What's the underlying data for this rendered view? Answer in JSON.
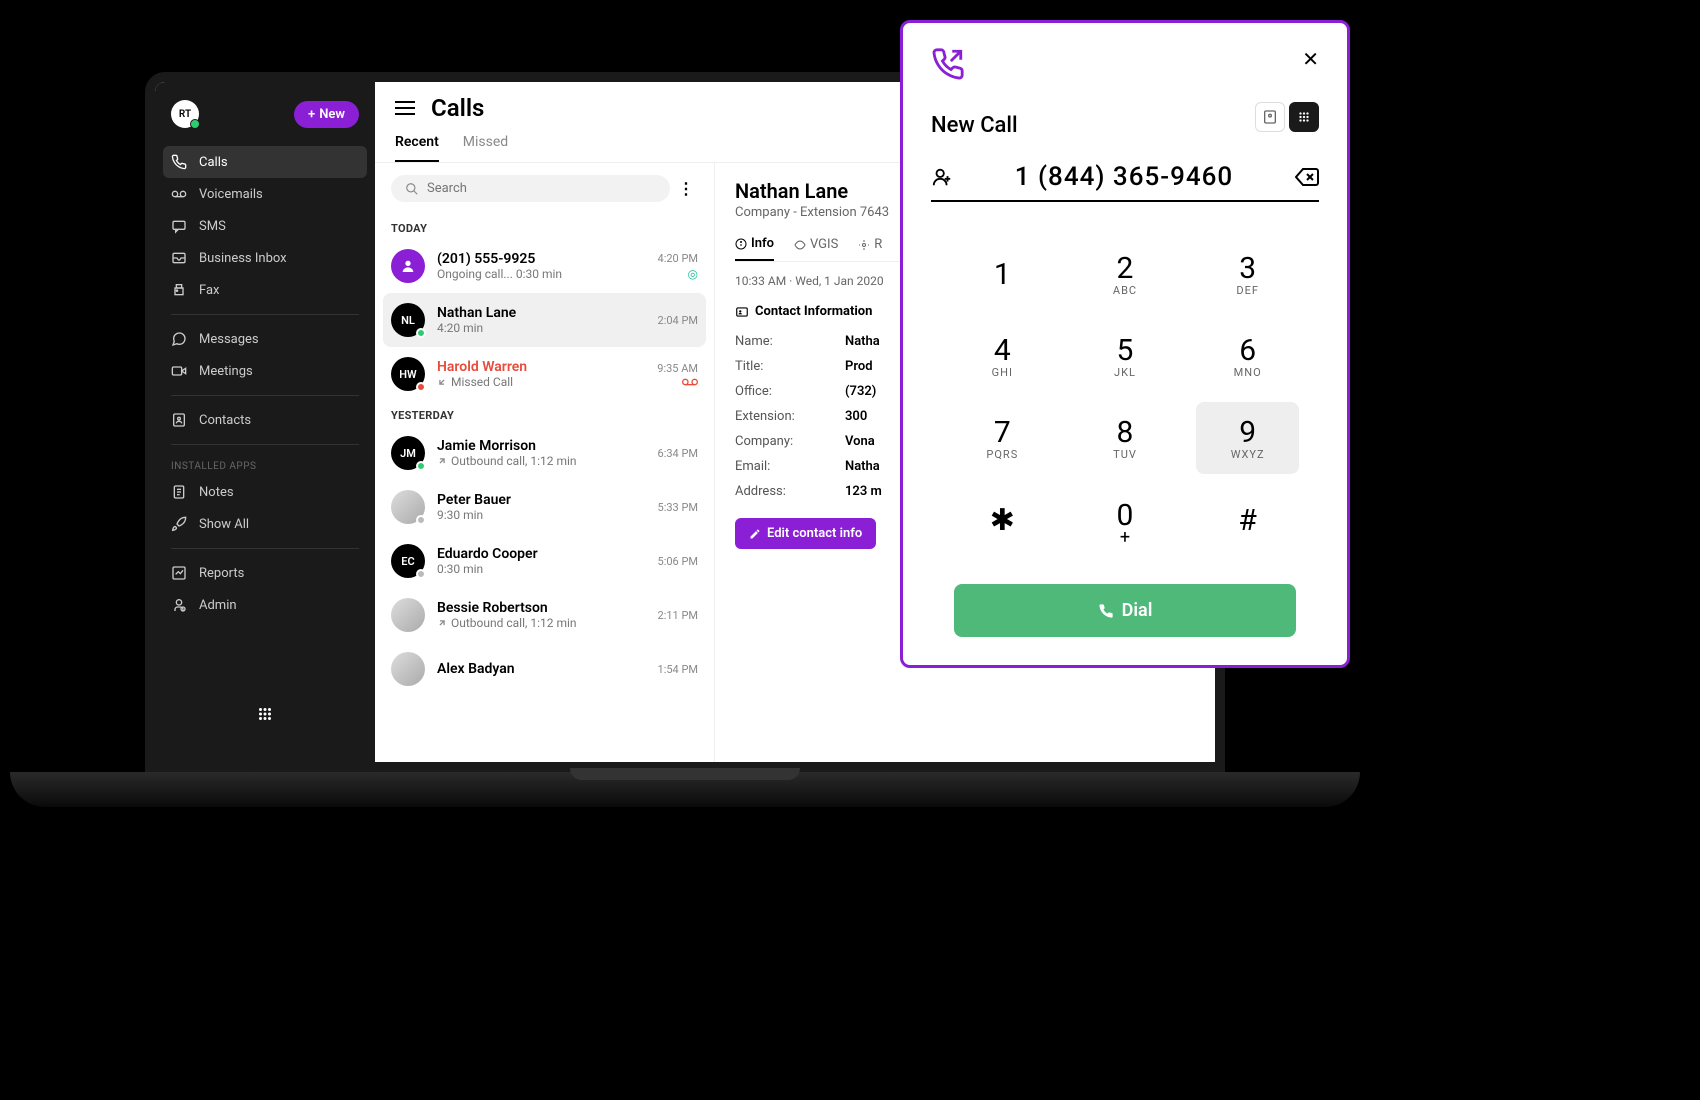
{
  "sidebar": {
    "avatar_initials": "RT",
    "new_button": "New",
    "items": [
      {
        "icon": "phone",
        "label": "Calls",
        "active": true
      },
      {
        "icon": "voicemail",
        "label": "Voicemails"
      },
      {
        "icon": "sms",
        "label": "SMS"
      },
      {
        "icon": "inbox",
        "label": "Business Inbox"
      },
      {
        "icon": "fax",
        "label": "Fax"
      }
    ],
    "comm": [
      {
        "icon": "message",
        "label": "Messages"
      },
      {
        "icon": "video",
        "label": "Meetings"
      }
    ],
    "contacts": {
      "icon": "contacts",
      "label": "Contacts"
    },
    "installed_header": "INSTALLED APPS",
    "installed": [
      {
        "icon": "notes",
        "label": "Notes"
      },
      {
        "icon": "rocket",
        "label": "Show All"
      }
    ],
    "footer": [
      {
        "icon": "reports",
        "label": "Reports"
      },
      {
        "icon": "admin",
        "label": "Admin"
      }
    ]
  },
  "main": {
    "title": "Calls",
    "tabs": [
      {
        "label": "Recent",
        "active": true
      },
      {
        "label": "Missed"
      }
    ],
    "search_placeholder": "Search",
    "groups": [
      {
        "label": "TODAY",
        "calls": [
          {
            "avatar": "icon",
            "color": "purple",
            "status": "none",
            "name": "(201) 555-9925",
            "sub": "Ongoing call... 0:30 min",
            "time": "4:20 PM",
            "badge": "live",
            "missed": false
          },
          {
            "avatar": "NL",
            "color": "dark",
            "status": "green",
            "name": "Nathan Lane",
            "sub": "4:20 min",
            "time": "2:04 PM",
            "selected": true
          },
          {
            "avatar": "HW",
            "color": "dark",
            "status": "red",
            "name": "Harold Warren",
            "sub": "Missed Call",
            "subicon": "missed",
            "time": "9:35 AM",
            "badge": "vm",
            "missed": true
          }
        ]
      },
      {
        "label": "YESTERDAY",
        "calls": [
          {
            "avatar": "JM",
            "color": "dark",
            "status": "green",
            "name": "Jamie Morrison",
            "sub": "Outbound call, 1:12 min",
            "subicon": "out",
            "time": "6:34 PM"
          },
          {
            "avatar": "img",
            "color": "img",
            "status": "gray",
            "name": "Peter Bauer",
            "sub": "9:30 min",
            "time": "5:33 PM"
          },
          {
            "avatar": "EC",
            "color": "dark",
            "status": "gray",
            "name": "Eduardo Cooper",
            "sub": "0:30 min",
            "time": "5:06 PM"
          },
          {
            "avatar": "img",
            "color": "img",
            "status": "none",
            "name": "Bessie Robertson",
            "sub": "Outbound call, 1:12 min",
            "subicon": "out",
            "time": "2:11 PM"
          },
          {
            "avatar": "img",
            "color": "img",
            "status": "none",
            "name": "Alex Badyan",
            "sub": "",
            "time": "1:54 PM"
          }
        ]
      }
    ]
  },
  "detail": {
    "name": "Nathan Lane",
    "subtitle": "Company -  Extension 7643",
    "tabs": [
      {
        "label": "Info",
        "active": true
      },
      {
        "label": "VGIS"
      },
      {
        "label": "R"
      }
    ],
    "meta": "10:33 AM  ·  Wed, 1 Jan 2020",
    "section": "Contact Information",
    "fields": [
      {
        "label": "Name:",
        "value": "Natha"
      },
      {
        "label": "Title:",
        "value": "Prod"
      },
      {
        "label": "Office:",
        "value": "(732)"
      },
      {
        "label": "Extension:",
        "value": "300"
      },
      {
        "label": "Company:",
        "value": "Vona"
      },
      {
        "label": "Email:",
        "value": "Natha"
      },
      {
        "label": "Address:",
        "value": "123 m"
      }
    ],
    "edit_button": "Edit contact info"
  },
  "dialer": {
    "title": "New Call",
    "number": "1 (844) 365-9460",
    "keys": [
      {
        "d": "1",
        "l": ""
      },
      {
        "d": "2",
        "l": "ABC"
      },
      {
        "d": "3",
        "l": "DEF"
      },
      {
        "d": "4",
        "l": "GHI"
      },
      {
        "d": "5",
        "l": "JKL"
      },
      {
        "d": "6",
        "l": "MNO"
      },
      {
        "d": "7",
        "l": "PQRS"
      },
      {
        "d": "8",
        "l": "TUV"
      },
      {
        "d": "9",
        "l": "WXYZ",
        "hover": true
      },
      {
        "d": "✱",
        "l": ""
      },
      {
        "d": "0",
        "l": "+"
      },
      {
        "d": "#",
        "l": ""
      }
    ],
    "dial_button": "Dial"
  }
}
